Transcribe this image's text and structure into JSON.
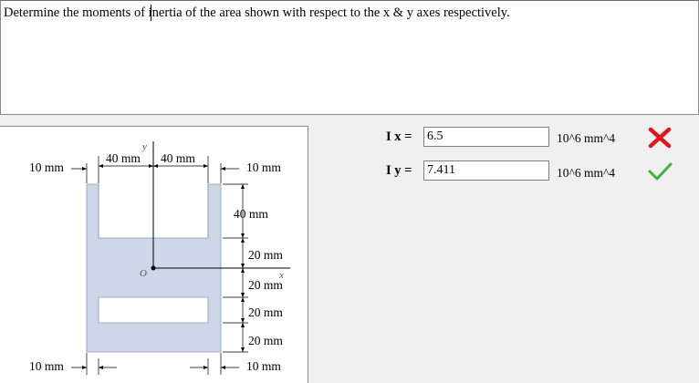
{
  "question": {
    "text": "Determine the moments of inertia of the area shown with respect to the x & y axes respectively."
  },
  "figure": {
    "labels": {
      "top_left_thickness": "10 mm",
      "left_half_width": "40 mm",
      "right_half_width": "40 mm",
      "top_right_thickness": "10 mm",
      "slot_height": "40 mm",
      "dim_20_a": "20 mm",
      "dim_20_b": "20 mm",
      "dim_20_c": "20 mm",
      "dim_20_d": "20 mm",
      "bottom_left_thickness": "10 mm",
      "bottom_right_thickness": "10 mm",
      "y_axis": "y",
      "x_axis": "x",
      "origin": "O"
    }
  },
  "answers": [
    {
      "label": "I x =",
      "value": "6.5",
      "units": "10^6 mm^4",
      "status": "incorrect",
      "status_icon": "x-mark-icon",
      "color": "#e0161b"
    },
    {
      "label": "I y =",
      "value": "7.411",
      "units": "10^6 mm^4",
      "status": "correct",
      "status_icon": "check-mark-icon",
      "color": "#3cb43c"
    }
  ]
}
